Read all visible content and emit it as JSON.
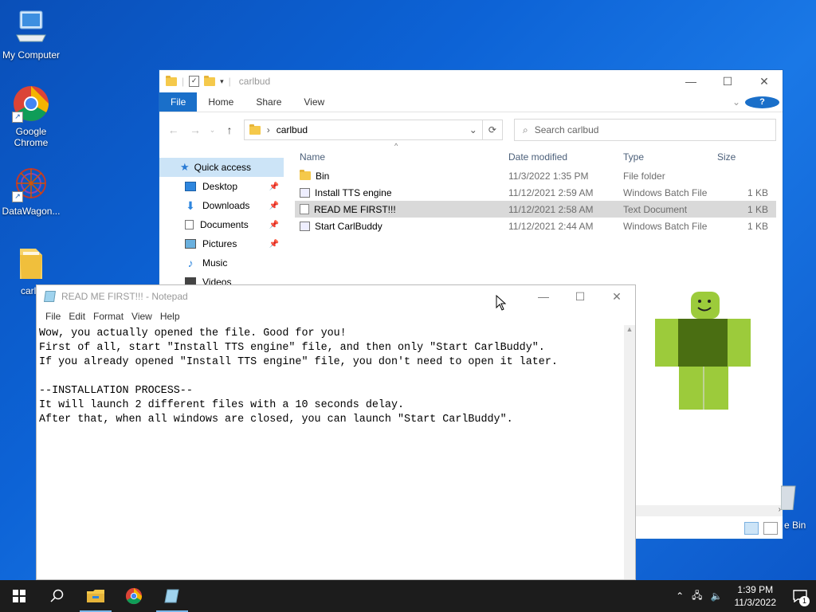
{
  "desktop": {
    "icons": [
      {
        "label": "My Computer"
      },
      {
        "label": "Google Chrome"
      },
      {
        "label": "DataWagon..."
      },
      {
        "label": "carlb"
      }
    ],
    "recycle_bin_label": "e Bin"
  },
  "explorer": {
    "title": "carlbud",
    "ribbon_tabs": [
      "File",
      "Home",
      "Share",
      "View"
    ],
    "address_path": "carlbud",
    "search_placeholder": "Search carlbud",
    "nav_items": [
      {
        "label": "Quick access",
        "icon": "star-icon"
      },
      {
        "label": "Desktop",
        "icon": "desktop-icon",
        "pinned": true
      },
      {
        "label": "Downloads",
        "icon": "download-icon",
        "pinned": true
      },
      {
        "label": "Documents",
        "icon": "documents-icon",
        "pinned": true
      },
      {
        "label": "Pictures",
        "icon": "pictures-icon",
        "pinned": true
      },
      {
        "label": "Music",
        "icon": "music-icon"
      },
      {
        "label": "Videos",
        "icon": "videos-icon"
      }
    ],
    "columns": {
      "name": "Name",
      "date": "Date modified",
      "type": "Type",
      "size": "Size"
    },
    "files": [
      {
        "name": "Bin",
        "date": "11/3/2022 1:35 PM",
        "type": "File folder",
        "size": "",
        "icon": "folder-icon"
      },
      {
        "name": "Install TTS engine",
        "date": "11/12/2021 2:59 AM",
        "type": "Windows Batch File",
        "size": "1 KB",
        "icon": "batch-file-icon"
      },
      {
        "name": "READ ME FIRST!!!",
        "date": "11/12/2021 2:58 AM",
        "type": "Text Document",
        "size": "1 KB",
        "icon": "text-file-icon",
        "selected": true
      },
      {
        "name": "Start CarlBuddy",
        "date": "11/12/2021 2:44 AM",
        "type": "Windows Batch File",
        "size": "1 KB",
        "icon": "batch-file-icon"
      }
    ]
  },
  "notepad": {
    "title": "READ ME FIRST!!! - Notepad",
    "menu": [
      "File",
      "Edit",
      "Format",
      "View",
      "Help"
    ],
    "lines": [
      "Wow, you actually opened the file. Good for you!",
      "First of all, start \"Install TTS engine\" file, and then only \"Start CarlBuddy\".",
      "If you already opened \"Install TTS engine\" file, you don't need to open it later.",
      "",
      "--INSTALLATION PROCESS--",
      "It will launch 2 different files with a 10 seconds delay.",
      "After that, when all windows are closed, you can launch \"Start CarlBuddy\"."
    ]
  },
  "taskbar": {
    "time": "1:39 PM",
    "date": "11/3/2022",
    "notification_count": "1",
    "colors": {
      "background": "#1c1c1c",
      "accent": "#7ab7ea"
    }
  }
}
